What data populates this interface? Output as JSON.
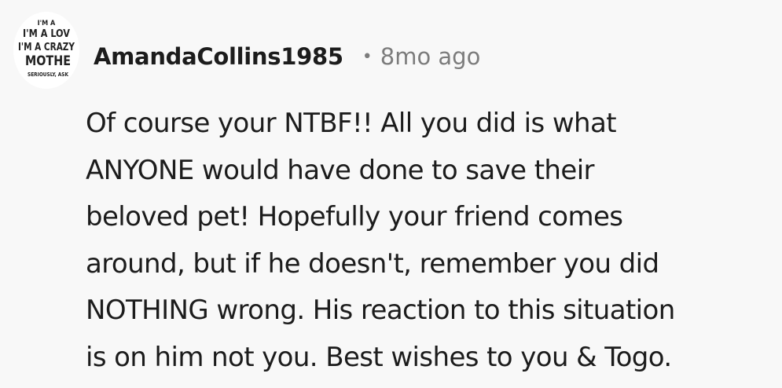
{
  "comment": {
    "avatar": {
      "icon": "avatar-text-logo",
      "lines": [
        "I'M A",
        "I'M A LOV",
        "I'M A CRAZY",
        "MOTHE",
        "SERIOUSLY, ASK"
      ]
    },
    "username": "AmandaCollins1985",
    "separator": "•",
    "timestamp": "8mo ago",
    "body_lines": [
      "Of course your NTBF!! All you did is what",
      "ANYONE would have done to save their",
      "beloved pet! Hopefully your friend comes",
      "around, but if he doesn't, remember you did",
      "NOTHING wrong. His reaction to this situation",
      "is on him not you. Best wishes to you & Togo."
    ]
  }
}
